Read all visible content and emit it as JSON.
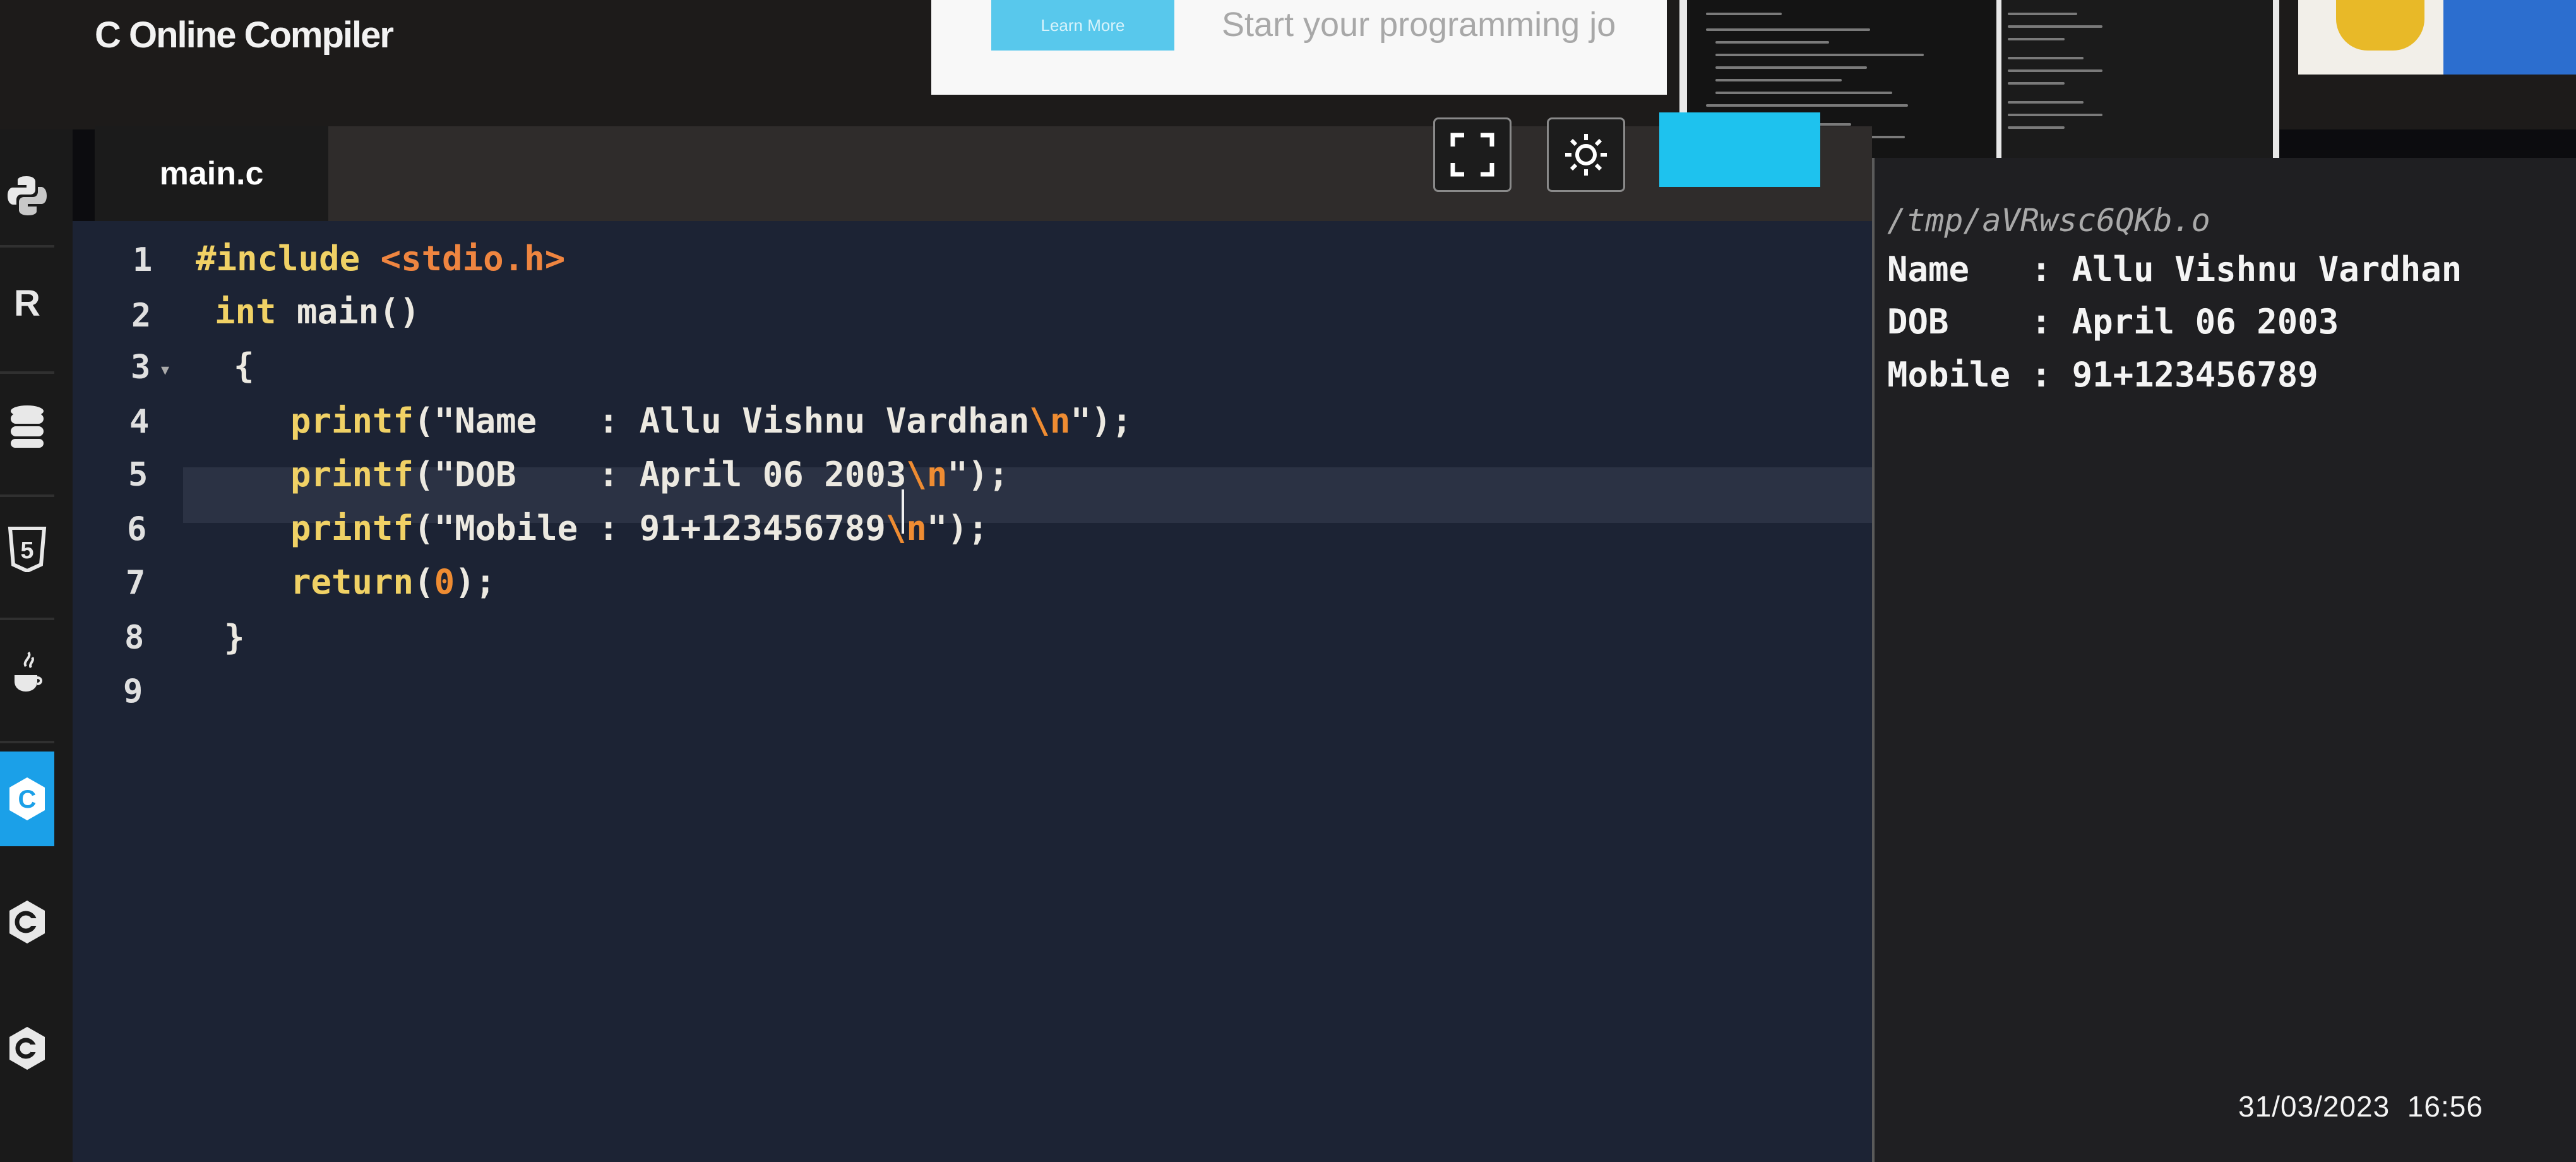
{
  "header": {
    "site_title": "C Online Compiler"
  },
  "ad": {
    "button_label": "Learn More",
    "text": "Start your programming jo"
  },
  "sidebar": {
    "items": [
      {
        "icon": "python-icon"
      },
      {
        "icon": "r-language-icon",
        "glyph": "R"
      },
      {
        "icon": "database-icon"
      },
      {
        "icon": "html5-icon",
        "glyph": "5"
      },
      {
        "icon": "java-icon"
      },
      {
        "icon": "c-language-icon",
        "glyph": "C",
        "active": true
      },
      {
        "icon": "cpp-icon"
      },
      {
        "icon": "csharp-icon"
      }
    ]
  },
  "editor": {
    "tab_label": "main.c",
    "line_numbers": [
      "1",
      "2",
      "3",
      "4",
      "5",
      "6",
      "7",
      "8",
      "9"
    ],
    "code": {
      "l1_directive": "#include",
      "l1_header": "<stdio.h>",
      "l2_type": "int",
      "l2_rest": " main()",
      "l3": "{",
      "l4_fn": "printf",
      "l4_str": "(\"Name   : Allu Vishnu Vardhan",
      "l5_fn": "printf",
      "l5_str": "(\"DOB    : April 06 2003",
      "l6_fn": "printf",
      "l6_str": "(\"Mobile : 91+123456789",
      "escape": "\\n",
      "str_end": "\");",
      "l7_kw": "return",
      "l7_open": "(",
      "l7_num": "0",
      "l7_close": ");",
      "l8": "}"
    }
  },
  "output": {
    "path": "/tmp/aVRwsc6QKb.o",
    "lines": [
      "Name   : Allu Vishnu Vardhan",
      "DOB    : April 06 2003",
      "Mobile : 91+123456789"
    ]
  },
  "photo_timestamp": "31/03/2023  16:56",
  "colors": {
    "editor_bg": "#1c2334",
    "accent": "#1ec2ee",
    "keyword": "#f0d165",
    "string_escape": "#ef8c32"
  }
}
